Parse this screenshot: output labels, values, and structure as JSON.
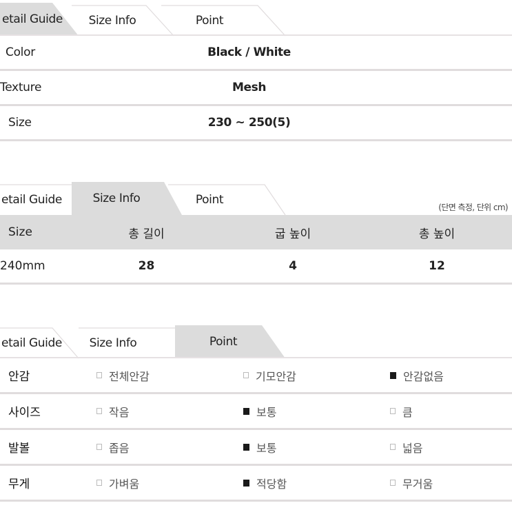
{
  "colors": {
    "active_tab_bg": "#dcdcdc",
    "divider": "#e0dcdd",
    "text": "#222222",
    "muted_text": "#555555",
    "checked": "#1a1a1a"
  },
  "tabs": [
    "Detail Guide",
    "Size Info",
    "Point"
  ],
  "tabs_display": [
    "etail Guide",
    "Size Info",
    "Point"
  ],
  "detail_guide": {
    "active_tab": "Detail Guide",
    "rows": [
      {
        "label": "Color",
        "value": "Black / White"
      },
      {
        "label": "Texture",
        "value": "Mesh"
      },
      {
        "label": "Size",
        "value": "230 ~ 250(5)"
      }
    ]
  },
  "size_info": {
    "active_tab": "Size Info",
    "note": "(단면 측정, 단위 cm)",
    "headers": [
      "Size",
      "총 길이",
      "굽 높이",
      "총 높이"
    ],
    "rows": [
      [
        "240mm",
        "28",
        "4",
        "12"
      ]
    ]
  },
  "point": {
    "active_tab": "Point",
    "rows": [
      {
        "label": "안감",
        "options": [
          {
            "text": "전체안감",
            "checked": false
          },
          {
            "text": "기모안감",
            "checked": false
          },
          {
            "text": "안감없음",
            "checked": true
          }
        ]
      },
      {
        "label": "사이즈",
        "options": [
          {
            "text": "작음",
            "checked": false
          },
          {
            "text": "보통",
            "checked": true
          },
          {
            "text": "큼",
            "checked": false
          }
        ]
      },
      {
        "label": "발볼",
        "options": [
          {
            "text": "좁음",
            "checked": false
          },
          {
            "text": "보통",
            "checked": true
          },
          {
            "text": "넓음",
            "checked": false
          }
        ]
      },
      {
        "label": "무게",
        "options": [
          {
            "text": "가벼움",
            "checked": false
          },
          {
            "text": "적당함",
            "checked": true
          },
          {
            "text": "무거움",
            "checked": false
          }
        ]
      }
    ]
  }
}
